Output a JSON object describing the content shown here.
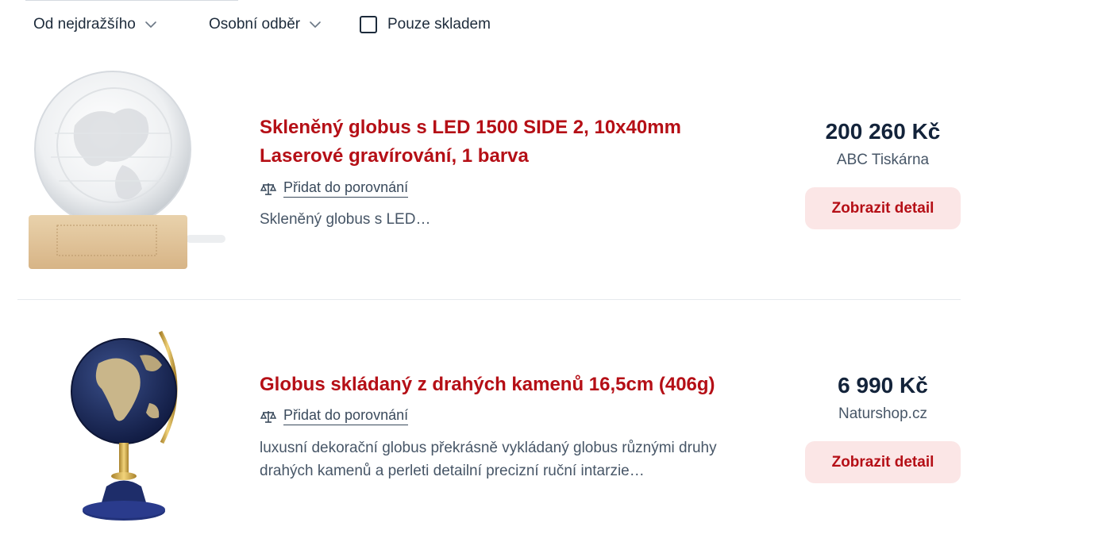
{
  "filters": {
    "sort_label": "Od nejdražšího",
    "pickup_label": "Osobní odběr",
    "in_stock_label": "Pouze skladem",
    "in_stock_checked": false
  },
  "products": [
    {
      "title": "Skleněný globus s LED 1500 SIDE 2, 10x40mm Laserové gravírování, 1 barva",
      "compare_label": "Přidat do porovnání",
      "description": "Skleněný globus s LED…",
      "price": "200 260 Kč",
      "shop": "ABC Tiskárna",
      "detail_label": "Zobrazit detail",
      "image": "glass-globe-led-image"
    },
    {
      "title": "Globus skládaný z drahých kamenů 16,5cm (406g)",
      "compare_label": "Přidat do porovnání",
      "description": "luxusní dekorační globus překrásně vykládaný globus různými druhy drahých kamenů a perleti detailní precizní ruční intarzie…",
      "price": "6 990 Kč",
      "shop": "Naturshop.cz",
      "detail_label": "Zobrazit detail",
      "image": "gemstone-globe-image"
    }
  ],
  "icons": {
    "dropdown": "chevron-down-icon",
    "compare": "scale-icon"
  },
  "colors": {
    "accent": "#b50f16",
    "button_bg": "#fbe6e6",
    "text_dark": "#13233a"
  }
}
